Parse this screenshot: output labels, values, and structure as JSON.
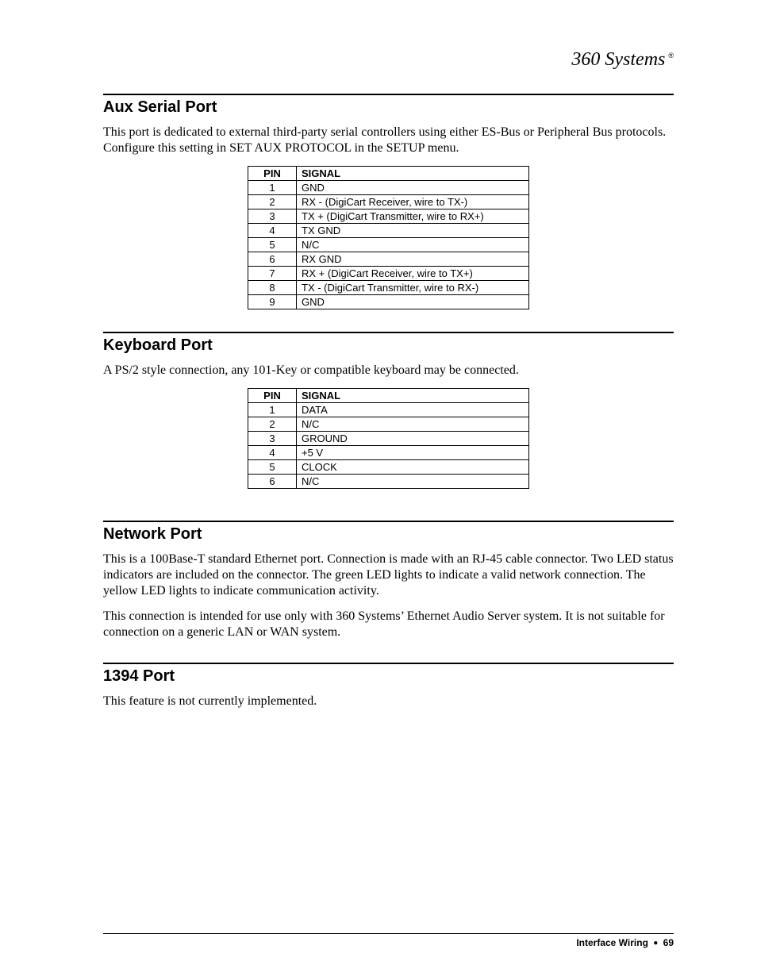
{
  "brand": {
    "name": "360 Systems",
    "tm": "®"
  },
  "sections": {
    "aux": {
      "title": "Aux Serial Port",
      "para": "This port is dedicated to external third-party serial controllers using either ES-Bus or Peripheral Bus protocols.  Configure this setting in SET AUX PROTOCOL in the SETUP menu.",
      "headers": {
        "pin": "PIN",
        "signal": "SIGNAL"
      },
      "rows": [
        {
          "pin": "1",
          "signal": "GND"
        },
        {
          "pin": "2",
          "signal": "RX -  (DigiCart Receiver, wire to TX-)"
        },
        {
          "pin": "3",
          "signal": "TX +  (DigiCart Transmitter, wire to RX+)"
        },
        {
          "pin": "4",
          "signal": "TX GND"
        },
        {
          "pin": "5",
          "signal": "N/C"
        },
        {
          "pin": "6",
          "signal": "RX GND"
        },
        {
          "pin": "7",
          "signal": "RX +  (DigiCart Receiver, wire to TX+)"
        },
        {
          "pin": "8",
          "signal": "TX -  (DigiCart Transmitter, wire to RX-)"
        },
        {
          "pin": "9",
          "signal": "GND"
        }
      ]
    },
    "kbd": {
      "title": "Keyboard Port",
      "para": "A PS/2 style connection, any 101-Key or compatible keyboard may be connected.",
      "headers": {
        "pin": "PIN",
        "signal": "SIGNAL"
      },
      "rows": [
        {
          "pin": "1",
          "signal": "DATA"
        },
        {
          "pin": "2",
          "signal": "N/C"
        },
        {
          "pin": "3",
          "signal": "GROUND"
        },
        {
          "pin": "4",
          "signal": "+5 V"
        },
        {
          "pin": "5",
          "signal": "CLOCK"
        },
        {
          "pin": "6",
          "signal": "N/C"
        }
      ]
    },
    "net": {
      "title": "Network Port",
      "para1": "This is a 100Base-T standard Ethernet port.  Connection is made with an RJ-45 cable connector.  Two LED status indicators are included on the connector.  The green LED lights to indicate a valid network connection.  The yellow LED lights to indicate communication activity.",
      "para2": "This connection is intended for use only with 360 Systems’ Ethernet Audio Server system.  It is not suitable for connection on a generic LAN or WAN system."
    },
    "p1394": {
      "title": "1394 Port",
      "para": "This feature is not currently implemented."
    }
  },
  "footer": {
    "section": "Interface Wiring",
    "page": "69"
  }
}
